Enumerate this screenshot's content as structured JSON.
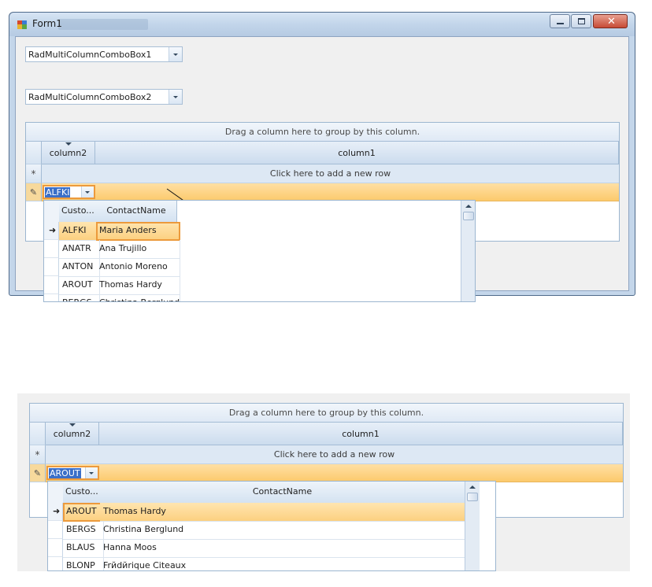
{
  "window": {
    "title": "Form1",
    "combo1": "RadMultiColumnComboBox1",
    "combo2": "RadMultiColumnComboBox2"
  },
  "grid": {
    "group_text": "Drag a column here to group by this column.",
    "col_a": "column2",
    "col_b": "column1",
    "new_row_text": "Click here to add a new row",
    "new_row_glyph": "*",
    "edit_glyph": "✎"
  },
  "top": {
    "editor_value": "ALFKI",
    "popup_headers": [
      "Custo...",
      "ContactName"
    ],
    "rows": [
      {
        "id": "ALFKI",
        "name": "Maria Anders"
      },
      {
        "id": "ANATR",
        "name": "Ana Trujillo"
      },
      {
        "id": "ANTON",
        "name": "Antonio Moreno"
      },
      {
        "id": "AROUT",
        "name": "Thomas Hardy"
      },
      {
        "id": "BERGS",
        "name": "Christina Berglund"
      }
    ]
  },
  "bottom": {
    "editor_value": "AROUT",
    "popup_headers": [
      "Custo...",
      "ContactName"
    ],
    "rows": [
      {
        "id": "AROUT",
        "name": "Thomas Hardy"
      },
      {
        "id": "BERGS",
        "name": "Christina Berglund"
      },
      {
        "id": "BLAUS",
        "name": "Hanna Moos"
      },
      {
        "id": "BLONP",
        "name": "Frйdйrique Citeaux"
      }
    ]
  },
  "colors": {
    "accent": "#ec9a3c",
    "selected_row": "#fcd080",
    "header": "#ccdcee"
  },
  "icons": [
    "app-icon",
    "minimize-icon",
    "maximize-icon",
    "close-icon",
    "dropdown-arrow-icon",
    "pencil-icon",
    "row-pointer-icon",
    "scroll-up-icon"
  ]
}
